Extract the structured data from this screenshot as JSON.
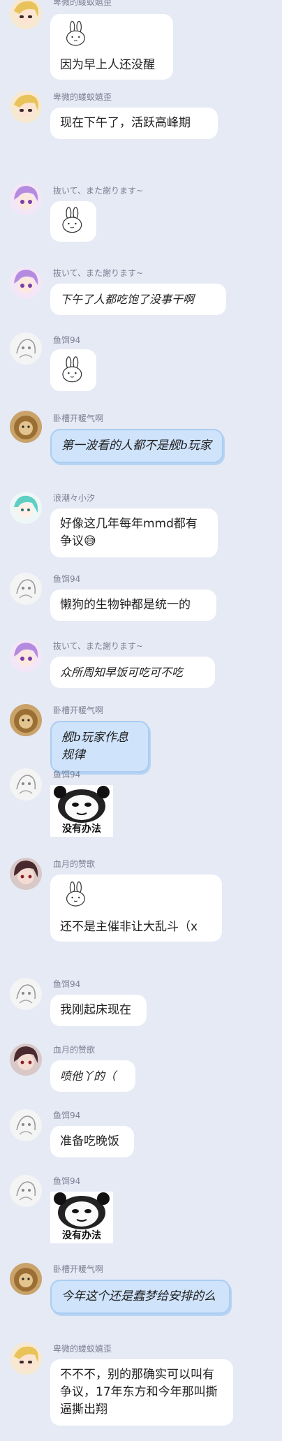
{
  "colors": {
    "background": "#e6eaf5",
    "bubble": "#ffffff",
    "blue_bubble": "#cfe3fb",
    "name_text": "#7b8194"
  },
  "messages": [
    {
      "sender": "卑微的蝼蚁嬉歪",
      "avatar": "blonde-girl-avatar",
      "sticker": "bunny-sticker",
      "text": "因为早上人还没醒"
    },
    {
      "sender": "卑微的蝼蚁嬉歪",
      "avatar": "blonde-girl-avatar",
      "text": "现在下午了，活跃高峰期"
    },
    {
      "sender": "抜いて、また謝ります~",
      "avatar": "purple-hair-avatar",
      "sticker": "bunny-sticker"
    },
    {
      "sender": "抜いて、また謝ります~",
      "avatar": "purple-hair-avatar",
      "text": "下午了人都吃饱了没事干啊"
    },
    {
      "sender": "鱼饵94",
      "avatar": "white-sketch-avatar",
      "sticker": "bunny-sticker"
    },
    {
      "sender": "卧槽开暖气啊",
      "avatar": "lion-avatar",
      "text": "第一波看的人都不是舰b玩家"
    },
    {
      "sender": "浪潮々小汐",
      "avatar": "teal-hair-avatar",
      "text": "好像这几年每年mmd都有争议",
      "emoji": "😅"
    },
    {
      "sender": "鱼饵94",
      "avatar": "white-sketch-avatar",
      "text": "懒狗的生物钟都是统一的"
    },
    {
      "sender": "抜いて、また謝ります~",
      "avatar": "purple-hair-avatar",
      "text": "众所周知早饭可吃可不吃"
    },
    {
      "sender": "卧槽开暖气啊",
      "avatar": "lion-avatar",
      "text": "舰b玩家作息规律"
    },
    {
      "sender": "鱼饵94",
      "avatar": "white-sketch-avatar",
      "panda_caption": "没有办法"
    },
    {
      "sender": "血月的赞歌",
      "avatar": "dark-hair-avatar",
      "sticker": "bunny-sticker",
      "text": "还不是主催非让大乱斗（x"
    },
    {
      "sender": "鱼饵94",
      "avatar": "white-sketch-avatar",
      "text": "我刚起床现在"
    },
    {
      "sender": "血月的赞歌",
      "avatar": "dark-hair-avatar",
      "text": "喷他丫的（"
    },
    {
      "sender": "鱼饵94",
      "avatar": "white-sketch-avatar",
      "text": "准备吃晚饭"
    },
    {
      "sender": "鱼饵94",
      "avatar": "white-sketch-avatar",
      "panda_caption": "没有办法"
    },
    {
      "sender": "卧槽开暖气啊",
      "avatar": "lion-avatar",
      "text": "今年这个还是蠢梦给安排的么"
    },
    {
      "sender": "卑微的蝼蚁嬉歪",
      "avatar": "blonde-girl-avatar",
      "text": "不不不，别的那确实可以叫有争议，17年东方和今年那叫撕逼撕出翔"
    }
  ]
}
